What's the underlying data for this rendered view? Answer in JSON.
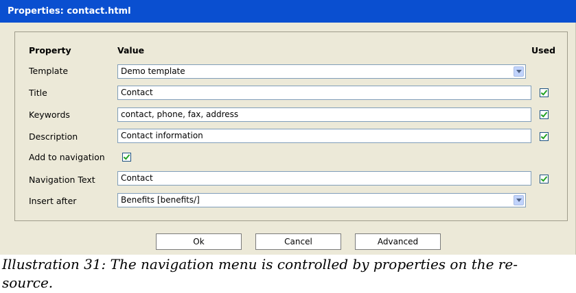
{
  "dialog": {
    "title": "Properties: contact.html",
    "headers": {
      "property": "Property",
      "value": "Value",
      "used": "Used"
    },
    "rows": {
      "template": {
        "label": "Template",
        "value": "Demo template"
      },
      "title": {
        "label": "Title",
        "value": "Contact"
      },
      "keywords": {
        "label": "Keywords",
        "value": "contact, phone, fax, address"
      },
      "description": {
        "label": "Description",
        "value": "Contact information"
      },
      "add_to_navigation": {
        "label": "Add to navigation"
      },
      "navigation_text": {
        "label": "Navigation Text",
        "value": "Contact"
      },
      "insert_after": {
        "label": "Insert after",
        "value": "Benefits [benefits/]"
      }
    },
    "buttons": {
      "ok": "Ok",
      "cancel": "Cancel",
      "advanced": "Advanced"
    }
  },
  "caption": {
    "line1": "Illustration 31: The navigation menu is controlled by properties on the re-",
    "line2": "source."
  }
}
